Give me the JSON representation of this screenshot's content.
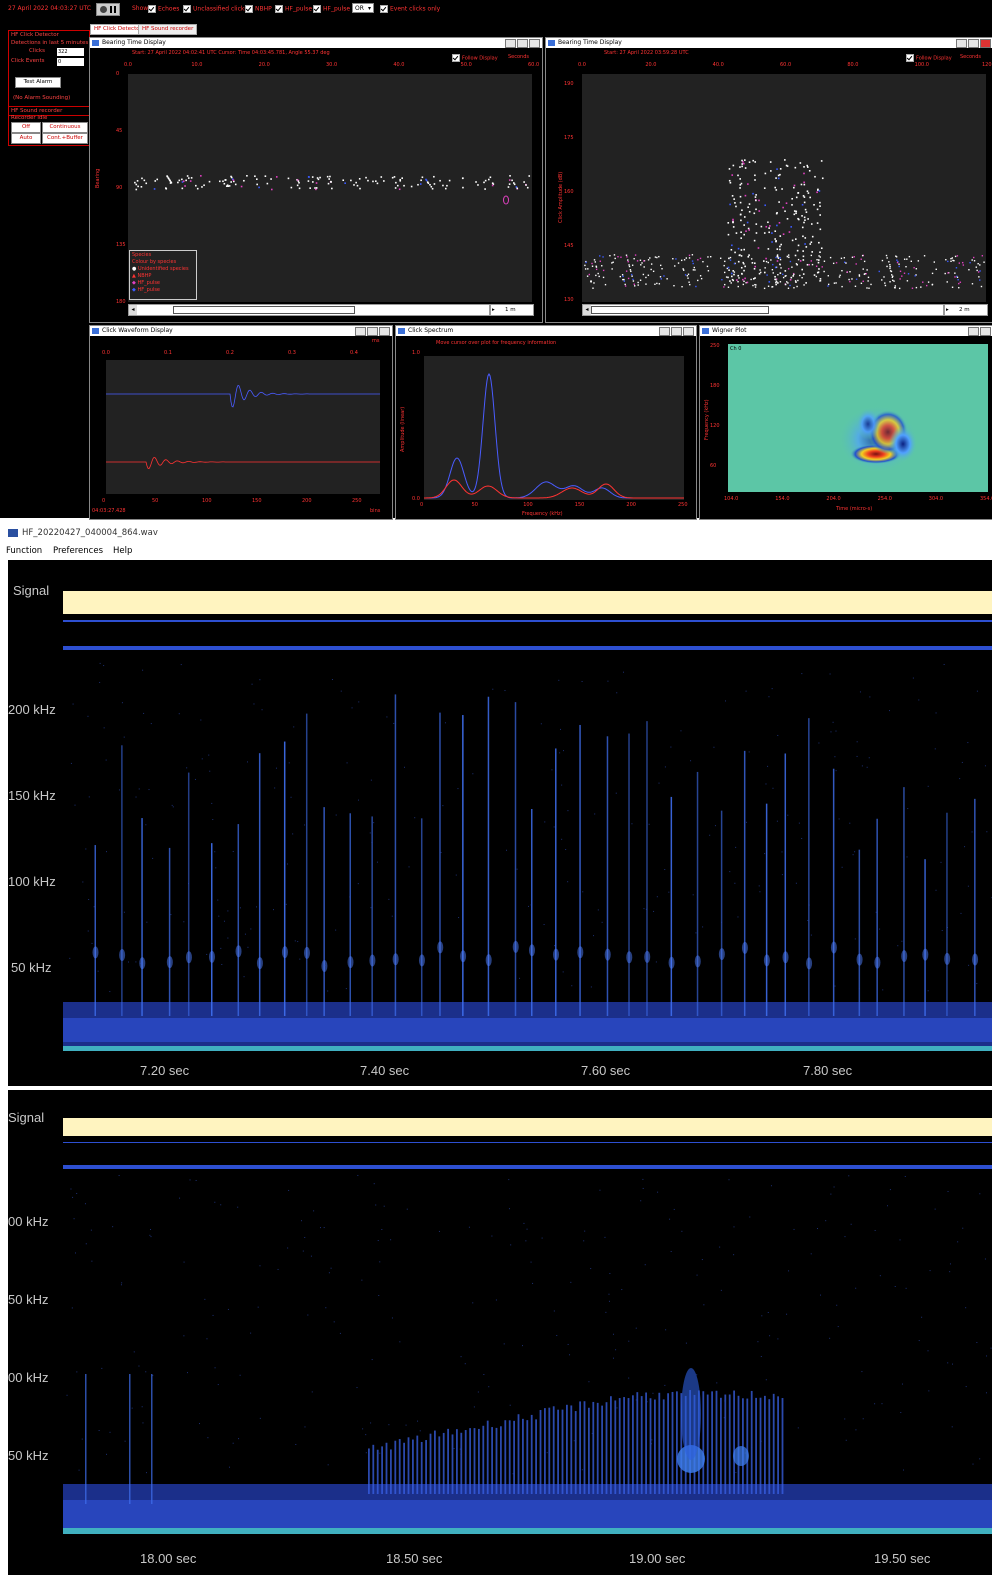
{
  "pamguard": {
    "datetime": "27 April 2022 04:03:27 UTC",
    "show_label": "Show",
    "filters": [
      "Echoes",
      "Unclassified clicks",
      "NBHP",
      "HF_pulse",
      "HF_pulse"
    ],
    "or_value": "OR",
    "event_clicks_only": "Event clicks only",
    "tabs": [
      "HF Click Detector",
      "HF Sound recorder"
    ],
    "left": {
      "section1": "HF Click Detector",
      "detections_label": "Detections in last 5 minutes",
      "clicks_label": "Clicks",
      "clicks_value": "322",
      "events_label": "Click Events",
      "events_value": "0",
      "test_alarm": "Test Alarm",
      "no_alarm": "(No Alarm Sounding)",
      "section2": "HF Sound recorder",
      "recorder_status": "Recorder idle",
      "buttons": [
        "Off",
        "Continuous",
        "Auto",
        "Cont.+Buffer"
      ]
    },
    "bearing1": {
      "title": "Bearing Time Display",
      "info": "Start: 27 April 2022 04:02:41 UTC   Cursor: Time 04:03:45.781, Angle 55.37 deg",
      "follow": "Follow Display",
      "seconds": "Seconds",
      "xticks": [
        "0.0",
        "10.0",
        "20.0",
        "30.0",
        "40.0",
        "50.0",
        "60.0"
      ],
      "yticks": [
        "0",
        "45",
        "90",
        "135",
        "180"
      ],
      "ylabel": "Bearing",
      "scroll_value": "1 m",
      "legend_title": "Species",
      "legend_sub": "Colour by species",
      "legend_items": [
        "Unidentified species",
        "NBHP",
        "HF_pulse",
        "HF_pulse"
      ]
    },
    "bearing2": {
      "title": "Bearing Time Display",
      "info": "Start: 27 April 2022 03:59:28 UTC",
      "follow": "Follow Display",
      "seconds": "Seconds",
      "xticks": [
        "0.0",
        "20.0",
        "40.0",
        "60.0",
        "80.0",
        "100.0",
        "120.0"
      ],
      "yticks": [
        "190",
        "175",
        "160",
        "145",
        "130"
      ],
      "ylabel": "Click Amplitude (dB)",
      "scroll_value": "2 m"
    },
    "waveform": {
      "title": "Click Waveform Display",
      "top_ticks": [
        "0.0",
        "0.1",
        "0.2",
        "0.3",
        "0.4"
      ],
      "top_unit": "ms",
      "bottom_ticks": [
        "0",
        "50",
        "100",
        "150",
        "200",
        "250"
      ],
      "bottom_unit": "bins",
      "timestamp": "04:03:27.428"
    },
    "spectrum": {
      "title": "Click Spectrum",
      "hint": "Move cursor over plot for frequency information",
      "ylabel": "Amplitude (linear)",
      "xlabel": "Frequency (kHz)",
      "y_top": "1.0",
      "y_bottom": "0.0",
      "xticks": [
        "0",
        "50",
        "100",
        "150",
        "200",
        "250"
      ]
    },
    "wigner": {
      "title": "Wigner Plot",
      "channel": "Ch 0",
      "ylabel": "Frequency (kHz)",
      "xlabel": "Time (micro-s)",
      "yticks": [
        "250",
        "180",
        "120",
        "60"
      ],
      "xticks": [
        "104.0",
        "154.0",
        "204.0",
        "254.0",
        "304.0",
        "354.0"
      ]
    }
  },
  "spectrogram1": {
    "file": "HF_20220427_040004_864.wav",
    "menu": [
      "Function",
      "Preferences",
      "Help"
    ],
    "signal_label": "Signal",
    "freq_labels": [
      "200 kHz",
      "150 kHz",
      "100 kHz",
      "50 kHz"
    ],
    "time_labels": [
      "7.20 sec",
      "7.40 sec",
      "7.60 sec",
      "7.80 sec"
    ]
  },
  "spectrogram2": {
    "signal_label": "Signal",
    "freq_labels": [
      "00 kHz",
      "50 kHz",
      "00 kHz",
      "50 kHz"
    ],
    "time_labels": [
      "18.00 sec",
      "18.50 sec",
      "19.00 sec",
      "19.50 sec"
    ]
  },
  "colors": {
    "accent_red": "#ff3333",
    "spectrogram_blue": "#2d4fd1",
    "signal_band": "#fff4c0"
  }
}
